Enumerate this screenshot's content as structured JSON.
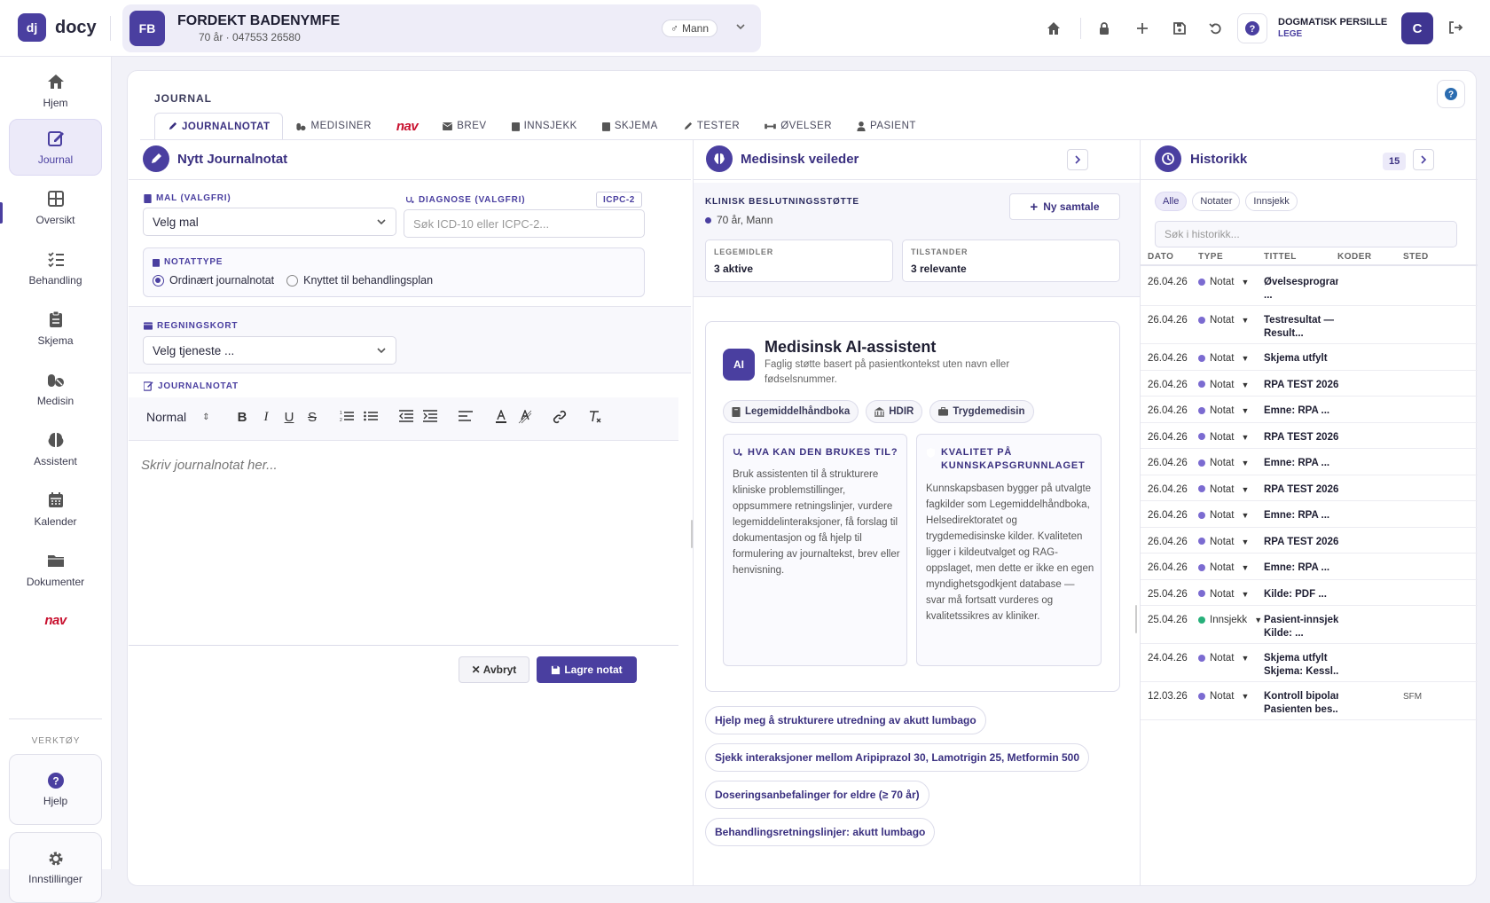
{
  "app": {
    "logo_text": "dj",
    "brand": "docy"
  },
  "patient": {
    "initials": "FB",
    "name": "FORDEKT BADENYMFE",
    "meta": "70 år · 047553 26580",
    "gender": "Mann",
    "gender_symbol": "♂"
  },
  "user": {
    "name": "DOGMATISK PERSILLE",
    "role": "LEGE",
    "initial": "C"
  },
  "sidebar": {
    "items": [
      {
        "label": "Hjem",
        "icon": "home-icon"
      },
      {
        "label": "Journal",
        "icon": "edit-icon",
        "active": true
      },
      {
        "label": "Oversikt",
        "icon": "grid-icon"
      },
      {
        "label": "Behandling",
        "icon": "checklist-icon"
      },
      {
        "label": "Skjema",
        "icon": "clipboard-icon"
      },
      {
        "label": "Medisin",
        "icon": "pills-icon"
      },
      {
        "label": "Assistent",
        "icon": "brain-icon"
      },
      {
        "label": "Kalender",
        "icon": "calendar-icon"
      },
      {
        "label": "Dokumenter",
        "icon": "folder-icon"
      },
      {
        "label": "nav",
        "icon": "nav-logo"
      }
    ],
    "tools_heading": "VERKTØY",
    "help_label": "Hjelp",
    "settings_label": "Innstillinger"
  },
  "journal": {
    "title": "JOURNAL",
    "tabs": [
      {
        "label": "JOURNALNOTAT",
        "active": true
      },
      {
        "label": "MEDISINER"
      },
      {
        "label": "nav"
      },
      {
        "label": "BREV"
      },
      {
        "label": "INNSJEKK"
      },
      {
        "label": "SKJEMA"
      },
      {
        "label": "TESTER"
      },
      {
        "label": "ØVELSER"
      },
      {
        "label": "PASIENT"
      }
    ]
  },
  "note": {
    "heading": "Nytt Journalnotat",
    "template_label": "MAL (VALGFRI)",
    "template_value": "Velg mal",
    "diagnosis_label": "DIAGNOSE (VALGFRI)",
    "diagnosis_badge": "ICPC-2",
    "diagnosis_placeholder": "Søk ICD-10 eller ICPC-2...",
    "notetype_label": "NOTATTYPE",
    "notetype_options": [
      "Ordinært journalnotat",
      "Knyttet til behandlingsplan"
    ],
    "billing_label": "REGNINGSKORT",
    "billing_value": "Velg tjeneste ...",
    "editor_label": "JOURNALNOTAT",
    "editor_style": "Normal",
    "editor_placeholder": "Skriv journalnotat her...",
    "cancel_label": "Avbryt",
    "save_label": "Lagre notat"
  },
  "advisor": {
    "heading": "Medisinsk veileder",
    "cds_label": "KLINISK BESLUTNINGSSTØTTE",
    "cds_patient": "70 år, Mann",
    "new_chat": "Ny samtale",
    "stats": [
      {
        "label": "LEGEMIDLER",
        "value": "3 aktive"
      },
      {
        "label": "TILSTANDER",
        "value": "3 relevante"
      }
    ],
    "ai_badge": "AI",
    "ai_title": "Medisinsk AI-assistent",
    "ai_subtitle": "Faglig støtte basert på pasientkontekst uten navn eller fødselsnummer.",
    "sources": [
      "Legemiddelhåndboka",
      "HDIR",
      "Trygdemedisin"
    ],
    "use_title": "HVA KAN DEN BRUKES TIL?",
    "use_body": "Bruk assistenten til å strukturere kliniske problemstillinger, oppsummere retningslinjer, vurdere legemiddelinteraksjoner, få forslag til dokumentasjon og få hjelp til formulering av journaltekst, brev eller henvisning.",
    "quality_title": "KVALITET PÅ KUNNSKAPSGRUNNLAGET",
    "quality_body": "Kunnskapsbasen bygger på utvalgte fagkilder som Legemiddelhåndboka, Helsedirektoratet og trygdemedisinske kilder. Kvaliteten ligger i kildeutvalget og RAG-oppslaget, men dette er ikke en egen myndighetsgodkjent database — svar må fortsatt vurderes og kvalitetssikres av kliniker.",
    "prompts": [
      "Hjelp meg å strukturere utredning av akutt lumbago",
      "Sjekk interaksjoner mellom Aripiprazol 30, Lamotrigin 25, Metformin 500",
      "Doseringsanbefalinger for eldre (≥ 70 år)",
      "Behandlingsretningslinjer: akutt lumbago"
    ]
  },
  "history": {
    "heading": "Historikk",
    "count": "15",
    "filters": [
      "Alle",
      "Notater",
      "Innsjekk"
    ],
    "search_placeholder": "Søk i historikk...",
    "columns": [
      "DATO",
      "TYPE",
      "TITTEL",
      "KODER",
      "STED"
    ],
    "rows": [
      {
        "date": "26.04.26",
        "type": "Notat",
        "title1": "Øvelsesprogram",
        "title2": "...",
        "sted": ""
      },
      {
        "date": "26.04.26",
        "type": "Notat",
        "title1": "Testresultat —",
        "title2": "Result...",
        "sted": ""
      },
      {
        "date": "26.04.26",
        "type": "Notat",
        "title1": "Skjema utfylt",
        "title2": "",
        "sted": ""
      },
      {
        "date": "26.04.26",
        "type": "Notat",
        "title1": "RPA TEST 2026",
        "title2": "",
        "sted": ""
      },
      {
        "date": "26.04.26",
        "type": "Notat",
        "title1": "Emne: RPA ...",
        "title2": "",
        "sted": ""
      },
      {
        "date": "26.04.26",
        "type": "Notat",
        "title1": "RPA TEST 2026",
        "title2": "",
        "sted": ""
      },
      {
        "date": "26.04.26",
        "type": "Notat",
        "title1": "Emne: RPA ...",
        "title2": "",
        "sted": ""
      },
      {
        "date": "26.04.26",
        "type": "Notat",
        "title1": "RPA TEST 2026",
        "title2": "",
        "sted": ""
      },
      {
        "date": "26.04.26",
        "type": "Notat",
        "title1": "Emne: RPA ...",
        "title2": "",
        "sted": ""
      },
      {
        "date": "26.04.26",
        "type": "Notat",
        "title1": "RPA TEST 2026",
        "title2": "",
        "sted": ""
      },
      {
        "date": "26.04.26",
        "type": "Notat",
        "title1": "Emne: RPA ...",
        "title2": "",
        "sted": ""
      },
      {
        "date": "25.04.26",
        "type": "Notat",
        "title1": "Kilde: PDF ...",
        "title2": "",
        "sted": ""
      },
      {
        "date": "25.04.26",
        "type": "Innsjekk",
        "title1": "Pasient-innsjekk",
        "title2": "Kilde: ...",
        "sted": ""
      },
      {
        "date": "24.04.26",
        "type": "Notat",
        "title1": "Skjema utfylt",
        "title2": "Skjema: Kessl...",
        "sted": ""
      },
      {
        "date": "12.03.26",
        "type": "Notat",
        "title1": "Kontroll bipolar",
        "title2": "Pasienten bes...",
        "sted": "SFM"
      }
    ]
  },
  "colors": {
    "accent": "#4a3fa0",
    "nav_red": "#c8102e",
    "innsjekk": "#27b07a",
    "notat": "#7b6bd1"
  }
}
